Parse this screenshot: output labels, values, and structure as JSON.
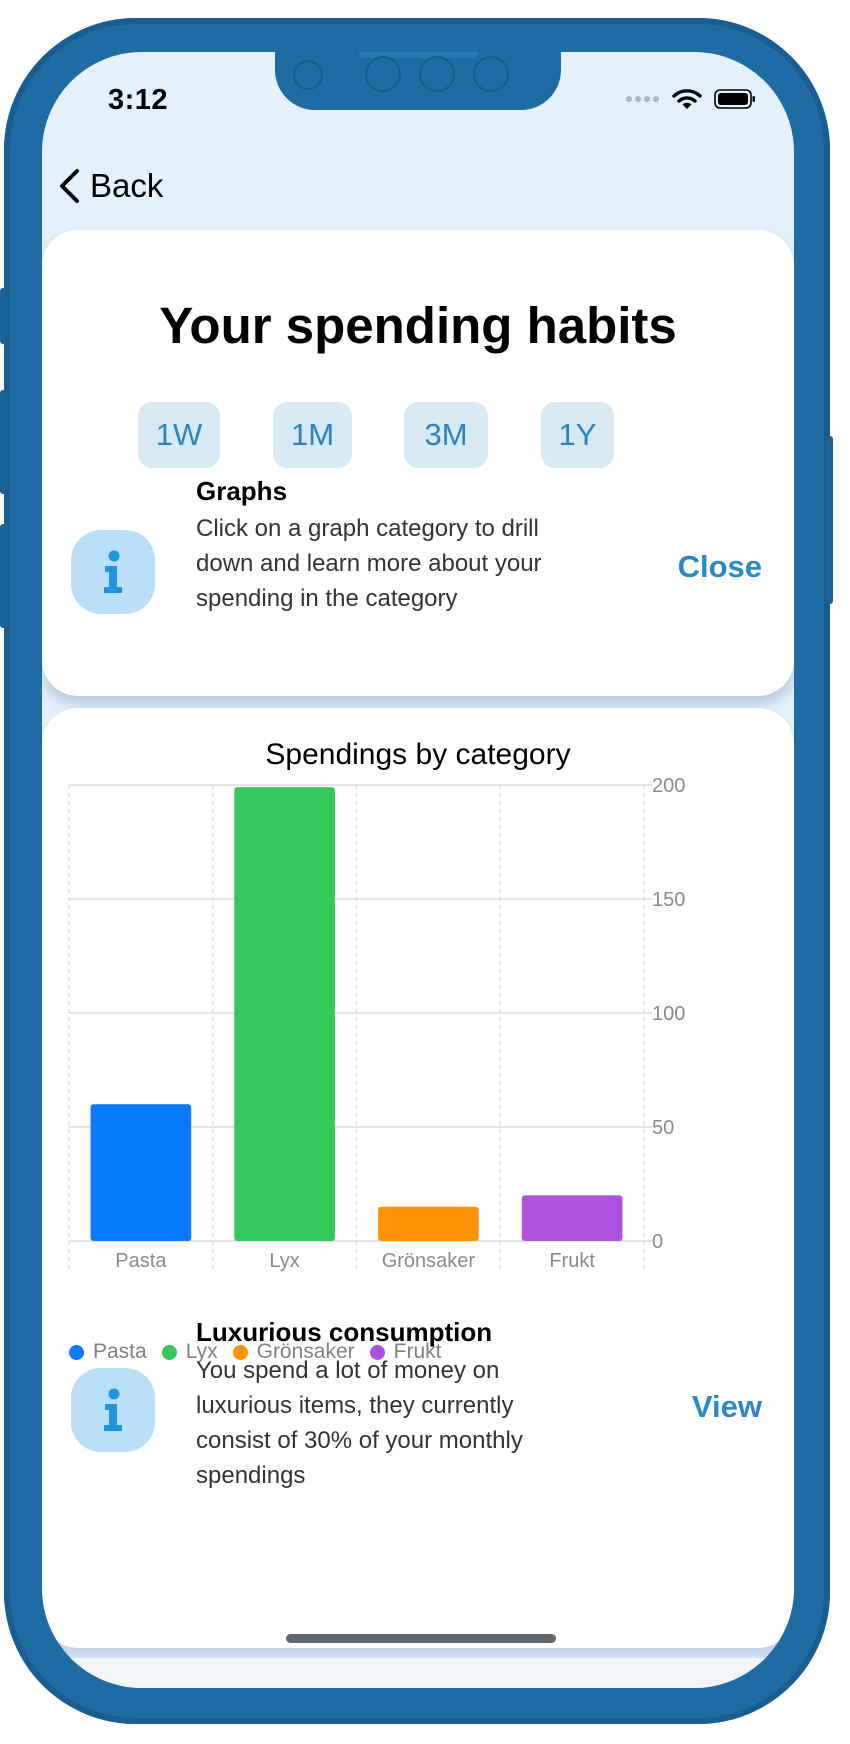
{
  "status_bar": {
    "time": "3:12",
    "icons": [
      "signal-dots-icon",
      "wifi-icon",
      "battery-icon"
    ]
  },
  "nav": {
    "back_label": "Back",
    "icon": "chevron-left-icon"
  },
  "header": {
    "title": "Your spending habits"
  },
  "time_ranges": [
    {
      "label": "1W"
    },
    {
      "label": "1M"
    },
    {
      "label": "3M"
    },
    {
      "label": "1Y"
    }
  ],
  "graphs_tip": {
    "icon": "info-icon",
    "title": "Graphs",
    "body": "Click on a graph category to drill down and learn more about your spending in the category",
    "action": "Close"
  },
  "chart_data": {
    "type": "bar",
    "title": "Spendings by category",
    "xlabel": "",
    "ylabel": "",
    "categories": [
      "Pasta",
      "Lyx",
      "Grönsaker",
      "Frukt"
    ],
    "values": [
      60,
      199,
      15,
      20
    ],
    "colors": [
      "#0a7aff",
      "#34c85a",
      "#ff9305",
      "#ad52de"
    ],
    "ylim": [
      0,
      200
    ],
    "yticks": [
      0,
      50,
      100,
      150,
      200
    ],
    "y_axis_side": "right",
    "grid": true,
    "legend": {
      "placement": "bottom-left",
      "entries": [
        "Pasta",
        "Lyx",
        "Grönsaker",
        "Frukt"
      ]
    }
  },
  "insight": {
    "icon": "info-icon",
    "title": "Luxurious consumption",
    "body": "You spend a lot of money on luxurious items, they currently consist of 30% of your monthly spendings",
    "action": "View"
  },
  "colors": {
    "accent": "#2b88c4",
    "frame": "#1f6ba3",
    "screen_bg": "#e4f1fd",
    "chip_bg": "#d6e9f4",
    "icon_bg": "#b9e0f8"
  }
}
